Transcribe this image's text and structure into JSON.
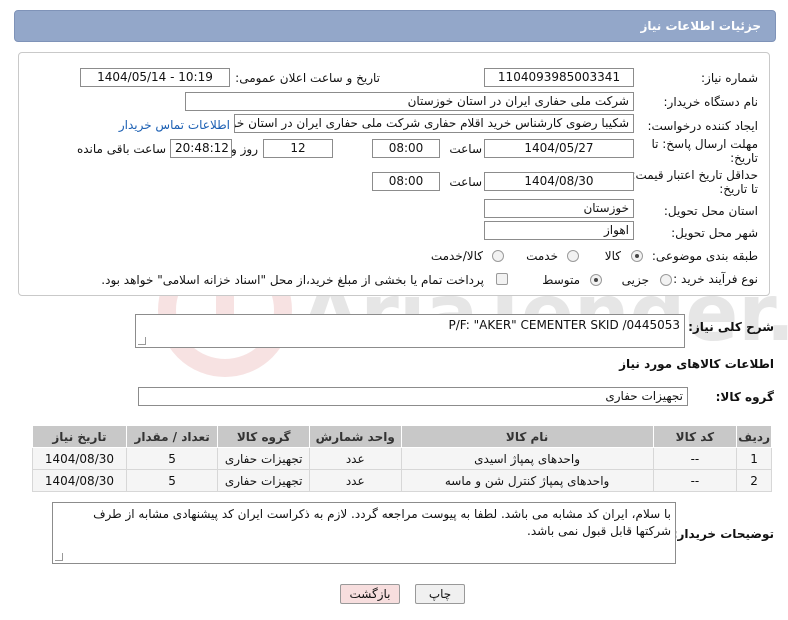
{
  "header": {
    "title": "جزئیات اطلاعات نیاز"
  },
  "form": {
    "need_number_label": "شماره نیاز:",
    "need_number": "1104093985003341",
    "announce_label": "تاریخ و ساعت اعلان عمومی:",
    "announce_value": "1404/05/14 - 10:19",
    "buyer_label": "نام دستگاه خریدار:",
    "buyer_value": "شرکت ملی حفاری ایران در استان خوزستان",
    "creator_label": "ایجاد کننده درخواست:",
    "creator_value": "شکیبا رضوی کارشناس خرید اقلام حفاری شرکت ملی حفاری ایران در استان خوزستان",
    "contact_link": "اطلاعات تماس خریدار",
    "deadline_label_1": "مهلت ارسال پاسخ: تا",
    "deadline_label_2": "تاریخ:",
    "deadline_date": "1404/05/27",
    "time_label": "ساعت",
    "deadline_time": "08:00",
    "days_value": "12",
    "days_label": "روز و",
    "remaining_time": "20:48:12",
    "remaining_label": "ساعت باقی مانده",
    "validity_label_1": "حداقل تاریخ اعتبار قیمت:",
    "validity_label_2": "تا تاریخ:",
    "validity_date": "1404/08/30",
    "validity_time": "08:00",
    "province_label": "استان محل تحویل:",
    "province_value": "خوزستان",
    "city_label": "شهر محل تحویل:",
    "city_value": "اهواز",
    "category_label": "طبقه بندی موضوعی:",
    "category_options": [
      "کالا",
      "خدمت",
      "کالا/خدمت"
    ],
    "process_label": "نوع فرآیند خرید :",
    "process_options": [
      "جزیی",
      "متوسط"
    ],
    "payment_note": "پرداخت تمام یا بخشی از مبلغ خرید،از محل \"اسناد خزانه اسلامی\" خواهد بود."
  },
  "description": {
    "label": "شرح کلی نیاز:",
    "value": "P/F: \"AKER\" CEMENTER SKID /0445053"
  },
  "goods": {
    "section_title": "اطلاعات کالاهای مورد نیاز",
    "group_label": "گروه کالا:",
    "group_value": "تجهیزات حفاری",
    "columns": [
      "ردیف",
      "کد کالا",
      "نام کالا",
      "واحد شمارش",
      "گروه کالا",
      "تعداد / مقدار",
      "تاریخ نیاز"
    ],
    "rows": [
      [
        "1",
        "--",
        "واحدهای پمپاژ اسیدی",
        "عدد",
        "تجهیزات حفاری",
        "5",
        "1404/08/30"
      ],
      [
        "2",
        "--",
        "واحدهای پمپاژ کنترل شن و ماسه",
        "عدد",
        "تجهیزات حفاری",
        "5",
        "1404/08/30"
      ]
    ]
  },
  "buyer_notes": {
    "label": "توضیحات خریدار:",
    "value": "با سلام، ایران کد مشابه می باشد. لطفا به پیوست مراجعه گردد. لازم به ذکراست ایران کد پیشنهادی مشابه از طرف شرکتها قابل قبول نمی باشد."
  },
  "buttons": {
    "print": "چاپ",
    "back": "بازگشت"
  },
  "watermark": {
    "text": "AriaTender.neT"
  },
  "colors": {
    "header": "#93a7c9",
    "link": "#1b5fb3",
    "back_button": "#f7dede"
  }
}
